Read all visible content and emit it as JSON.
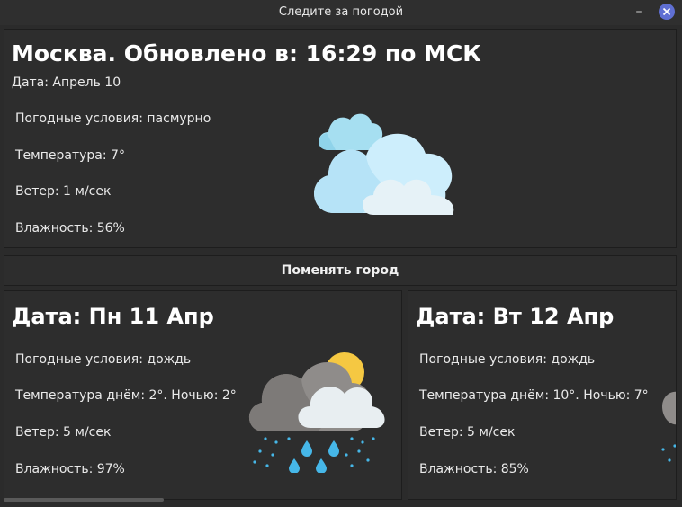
{
  "window": {
    "title": "Следите за погодой"
  },
  "current": {
    "heading": "Москва. Обновлено в: 16:29 по МСК",
    "date": "Дата: Апрель 10",
    "conditions": "Погодные условия: пасмурно",
    "temperature": "Температура: 7°",
    "wind": "Ветер: 1 м/сек",
    "humidity": "Влажность: 56%",
    "icon": "cloudy-icon"
  },
  "change_city_label": "Поменять город",
  "forecast": [
    {
      "heading": "Дата: Пн 11 Апр",
      "conditions": "Погодные условия: дождь",
      "temperature": "Температура днём: 2°. Ночью: 2°",
      "wind": "Ветер: 5 м/сек",
      "humidity": "Влажность: 97%",
      "icon": "rain-icon"
    },
    {
      "heading": "Дата: Вт 12 Апр",
      "conditions": "Погодные условия: дождь",
      "temperature": "Температура днём: 10°. Ночью: 7°",
      "wind": "Ветер: 5 м/сек",
      "humidity": "Влажность: 85%",
      "icon": "rain-icon"
    }
  ],
  "colors": {
    "background": "#2b2b2b",
    "panel": "#2d2d2d",
    "close_button": "#5f6fd3"
  }
}
